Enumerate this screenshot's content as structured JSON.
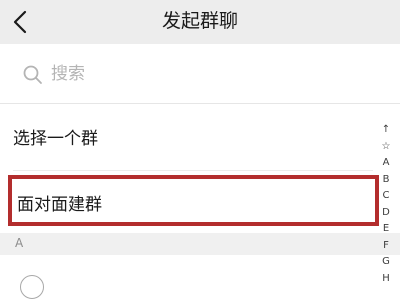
{
  "header": {
    "title": "发起群聊",
    "back_icon": "chevron-left-icon"
  },
  "search": {
    "icon": "search-icon",
    "placeholder": "搜索"
  },
  "options": {
    "select_group": "选择一个群",
    "face_to_face": "面对面建群",
    "face_to_face_highlight_color": "#b32d2d"
  },
  "section": {
    "label": "A"
  },
  "index_bar": {
    "items": [
      "↑",
      "☆",
      "A",
      "B",
      "C",
      "D",
      "E",
      "F",
      "G",
      "H"
    ]
  }
}
